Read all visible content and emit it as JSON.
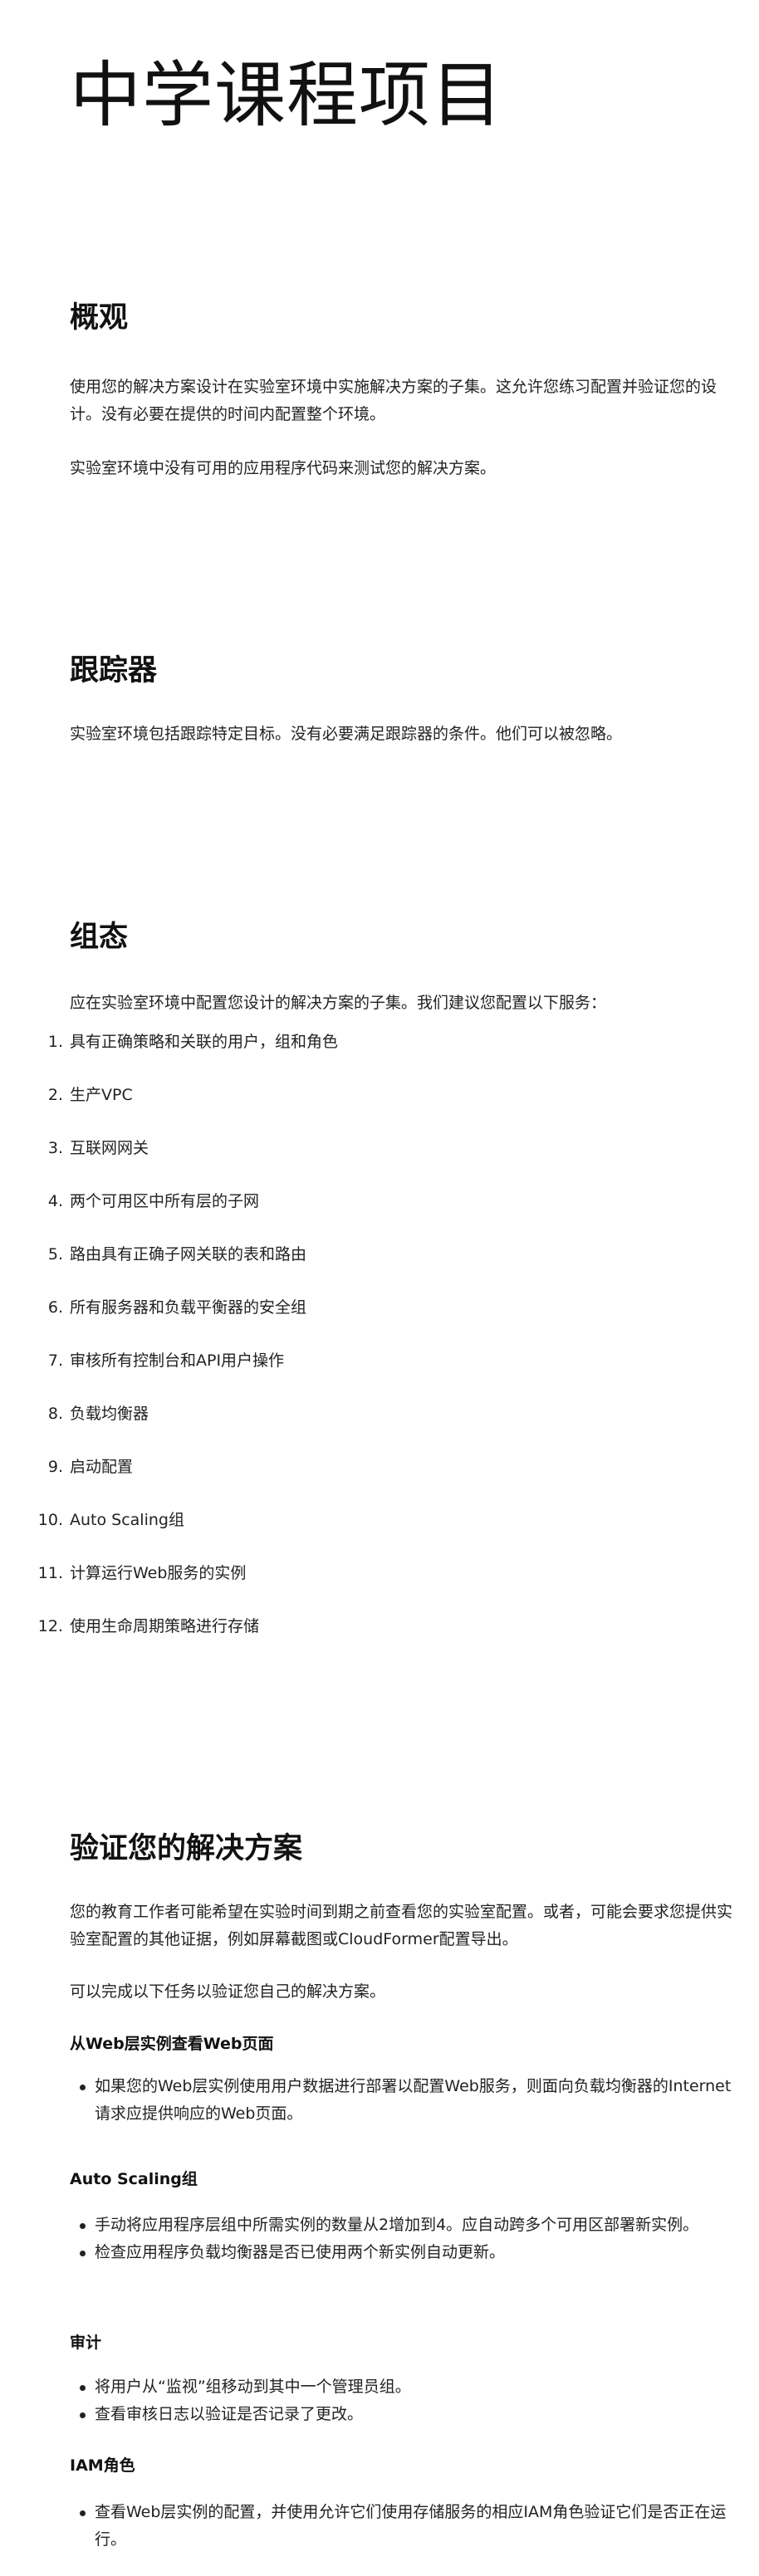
{
  "title": "中学课程项目",
  "overview": {
    "heading": "概观",
    "p1": "使用您的解决方案设计在实验室环境中实施解决方案的子集。这允许您练习配置并验证您的设计。没有必要在提供的时间内配置整个环境。",
    "p2": "实验室环境中没有可用的应用程序代码来测试您的解决方案。"
  },
  "trackers": {
    "heading": "跟踪器",
    "p1": "实验室环境包括跟踪特定目标。没有必要满足跟踪器的条件。他们可以被忽略。"
  },
  "config": {
    "heading": "组态",
    "intro": "应在实验室环境中配置您设计的解决方案的子集。我们建议您配置以下服务：",
    "items": [
      {
        "num": "1.",
        "text": "具有正确策略和关联的用户，组和角色"
      },
      {
        "num": "2.",
        "text": "生产VPC"
      },
      {
        "num": "3.",
        "text": "互联网网关"
      },
      {
        "num": "4.",
        "text": "两个可用区中所有层的子网"
      },
      {
        "num": "5.",
        "text": "路由具有正确子网关联的表和路由"
      },
      {
        "num": "6.",
        "text": "所有服务器和负载平衡器的安全组"
      },
      {
        "num": "7.",
        "text": "审核所有控制台和API用户操作"
      },
      {
        "num": "8.",
        "text": "负载均衡器"
      },
      {
        "num": "9.",
        "text": "启动配置"
      },
      {
        "num": "10.",
        "text": "Auto Scaling组"
      },
      {
        "num": "11.",
        "text": "计算运行Web服务的实例"
      },
      {
        "num": "12.",
        "text": "使用生命周期策略进行存储"
      }
    ]
  },
  "verify": {
    "heading": "验证您的解决方案",
    "p1": "您的教育工作者可能希望在实验时间到期之前查看您的实验室配置。或者，可能会要求您提供实验室配置的其他证据，例如屏幕截图或CloudFormer配置导出。",
    "p2": "可以完成以下任务以验证您自己的解决方案。",
    "sections": [
      {
        "heading": "从Web层实例查看Web页面",
        "items": [
          "如果您的Web层实例使用用户数据进行部署以配置Web服务，则面向负载均衡器的Internet请求应提供响应的Web页面。"
        ]
      },
      {
        "heading": "Auto Scaling组",
        "items": [
          "手动将应用程序层组中所需实例的数量从2增加到4。应自动跨多个可用区部署新实例。",
          "检查应用程序负载均衡器是否已使用两个新实例自动更新。"
        ]
      },
      {
        "heading": "审计",
        "items": [
          "将用户从“监视”组移动到其中一个管理员组。",
          "查看审核日志以验证是否记录了更改。"
        ]
      },
      {
        "heading": "IAM角色",
        "items": [
          "查看Web层实例的配置，并使用允许它们使用存储服务的相应IAM角色验证它们是否正在运行。"
        ]
      }
    ]
  }
}
